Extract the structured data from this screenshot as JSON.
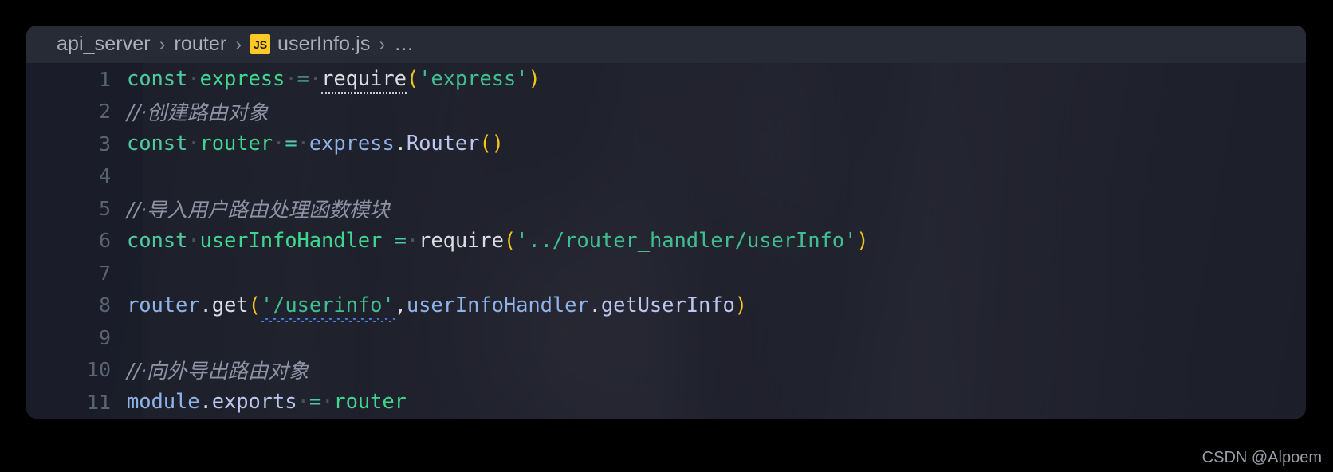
{
  "window": {
    "app": "vscode-editor"
  },
  "breadcrumb": {
    "items": [
      {
        "label": "api_server",
        "icon": null
      },
      {
        "label": "router",
        "icon": null
      },
      {
        "label": "userInfo.js",
        "icon": "js-file-icon",
        "badge": "JS"
      }
    ],
    "separator": "›",
    "ellipsis": "…"
  },
  "colors": {
    "editor_background": "#1a1e29",
    "breadcrumb_background": "#262b36",
    "page_background": "#000000",
    "keyword": "#4ec9a0",
    "variable": "#3fd68f",
    "string": "#3fbf8f",
    "paren": "#f5c518",
    "function": "#dcdde3",
    "property": "#bcc6ee",
    "object": "#8fb3e8",
    "comment": "#8d93a5",
    "line_number": "#5a6372",
    "js_badge": "#ffca28",
    "squiggly_underline": "#4a7ee0"
  },
  "editor": {
    "language": "javascript",
    "file_name": "userInfo.js",
    "lines": [
      {
        "number": "1",
        "tokens": [
          {
            "text": "const",
            "cls": "t-kw"
          },
          {
            "text": "·",
            "cls": "t-ws"
          },
          {
            "text": "express",
            "cls": "t-var"
          },
          {
            "text": "·",
            "cls": "t-ws"
          },
          {
            "text": "=",
            "cls": "t-op"
          },
          {
            "text": "·",
            "cls": "t-ws"
          },
          {
            "text": "require",
            "cls": "t-fn underline-dot"
          },
          {
            "text": "(",
            "cls": "t-paren"
          },
          {
            "text": "'express'",
            "cls": "t-str"
          },
          {
            "text": ")",
            "cls": "t-paren"
          }
        ]
      },
      {
        "number": "2",
        "tokens": [
          {
            "text": "//·创建路由对象",
            "cls": "t-comment"
          }
        ]
      },
      {
        "number": "3",
        "tokens": [
          {
            "text": "const",
            "cls": "t-kw"
          },
          {
            "text": "·",
            "cls": "t-ws"
          },
          {
            "text": "router",
            "cls": "t-var"
          },
          {
            "text": "·",
            "cls": "t-ws"
          },
          {
            "text": "=",
            "cls": "t-op"
          },
          {
            "text": "·",
            "cls": "t-ws"
          },
          {
            "text": "express",
            "cls": "t-obj"
          },
          {
            "text": ".",
            "cls": "t-plain"
          },
          {
            "text": "Router",
            "cls": "t-prop"
          },
          {
            "text": "()",
            "cls": "t-paren"
          }
        ]
      },
      {
        "number": "4",
        "tokens": []
      },
      {
        "number": "5",
        "tokens": [
          {
            "text": "//·导入用户路由处理函数模块",
            "cls": "t-comment"
          }
        ]
      },
      {
        "number": "6",
        "tokens": [
          {
            "text": "const",
            "cls": "t-kw"
          },
          {
            "text": "·",
            "cls": "t-ws"
          },
          {
            "text": "userInfoHandler",
            "cls": "t-var"
          },
          {
            "text": " ",
            "cls": "t-ws"
          },
          {
            "text": "=",
            "cls": "t-op"
          },
          {
            "text": "·",
            "cls": "t-ws"
          },
          {
            "text": "require",
            "cls": "t-fn"
          },
          {
            "text": "(",
            "cls": "t-paren"
          },
          {
            "text": "'../router_handler/userInfo'",
            "cls": "t-str"
          },
          {
            "text": ")",
            "cls": "t-paren"
          }
        ]
      },
      {
        "number": "7",
        "tokens": []
      },
      {
        "number": "8",
        "tokens": [
          {
            "text": "router",
            "cls": "t-obj"
          },
          {
            "text": ".",
            "cls": "t-plain"
          },
          {
            "text": "get",
            "cls": "t-method"
          },
          {
            "text": "(",
            "cls": "t-paren"
          },
          {
            "text": "'/userinfo'",
            "cls": "t-str squiggly"
          },
          {
            "text": ",",
            "cls": "t-plain"
          },
          {
            "text": "userInfoHandler",
            "cls": "t-obj"
          },
          {
            "text": ".",
            "cls": "t-plain"
          },
          {
            "text": "getUserInfo",
            "cls": "t-prop"
          },
          {
            "text": ")",
            "cls": "t-paren"
          }
        ]
      },
      {
        "number": "9",
        "tokens": []
      },
      {
        "number": "10",
        "tokens": [
          {
            "text": "//·向外导出路由对象",
            "cls": "t-comment"
          }
        ]
      },
      {
        "number": "11",
        "tokens": [
          {
            "text": "module",
            "cls": "t-obj"
          },
          {
            "text": ".",
            "cls": "t-plain"
          },
          {
            "text": "exports",
            "cls": "t-prop"
          },
          {
            "text": "·",
            "cls": "t-ws"
          },
          {
            "text": "=",
            "cls": "t-op"
          },
          {
            "text": "·",
            "cls": "t-ws"
          },
          {
            "text": "router",
            "cls": "t-var"
          }
        ]
      }
    ]
  },
  "watermark": {
    "text": "CSDN @Alpoem"
  }
}
